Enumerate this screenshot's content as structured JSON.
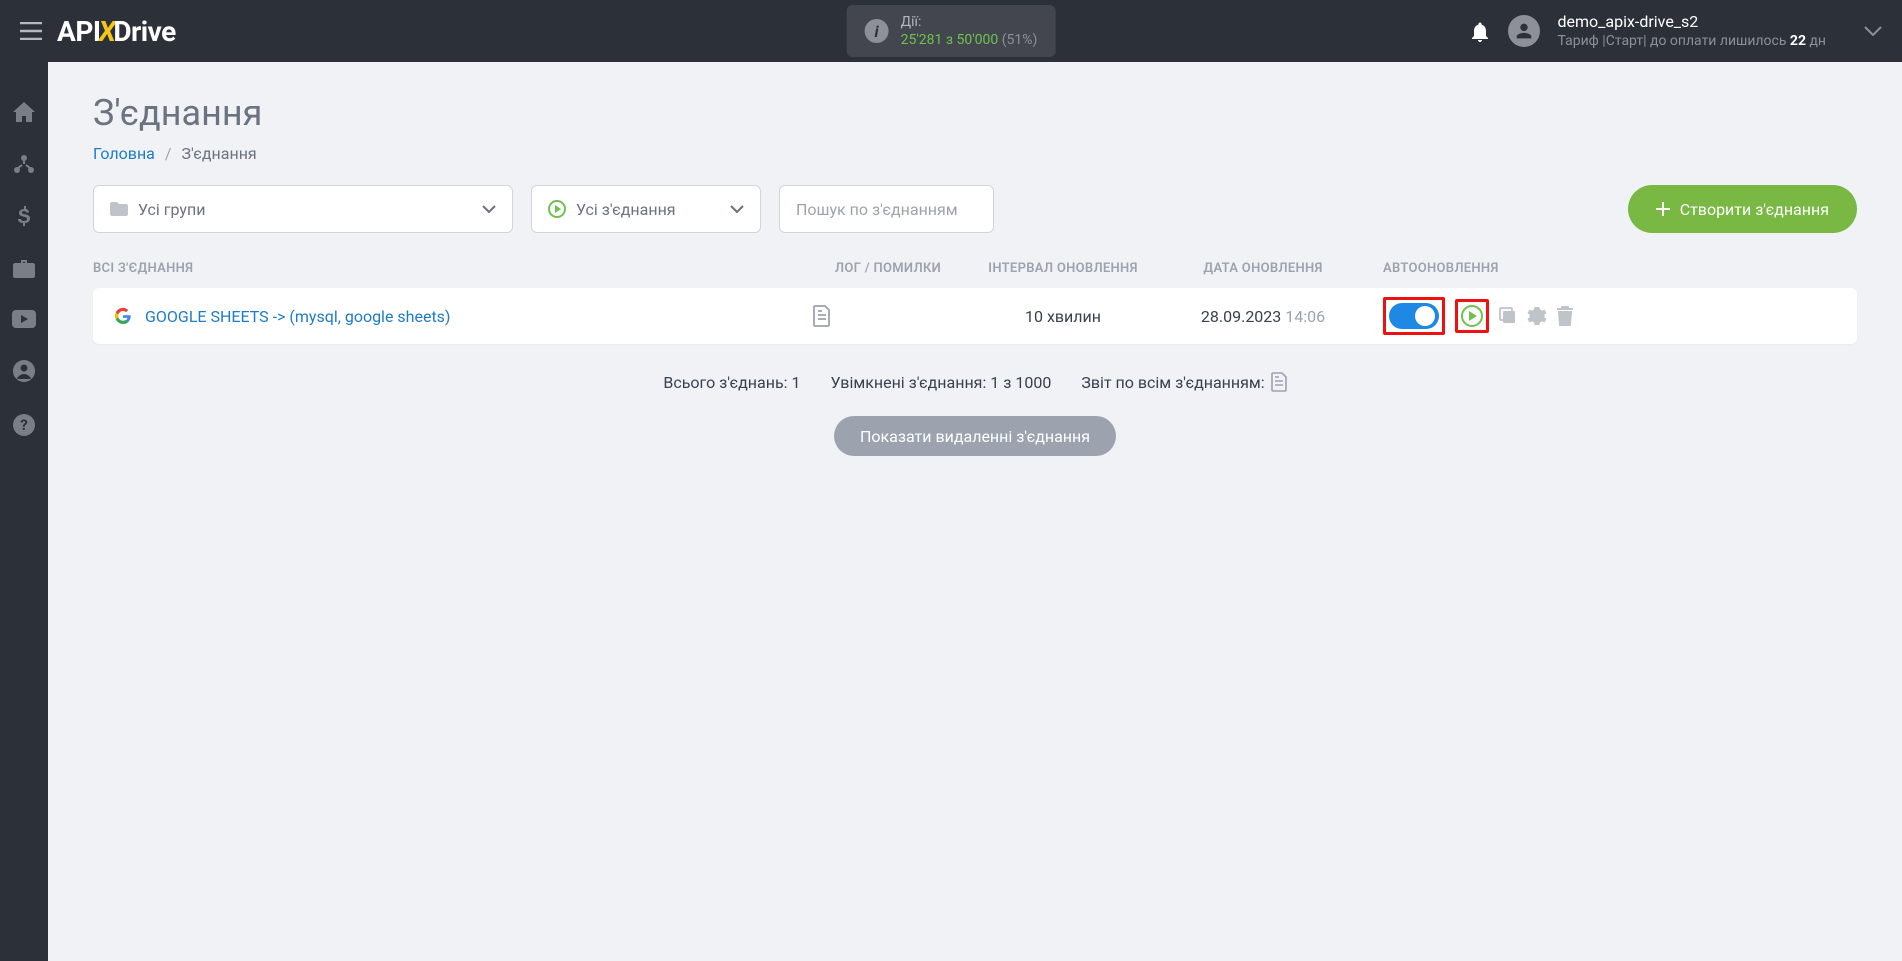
{
  "header": {
    "logo_pre": "API",
    "logo_x": "X",
    "logo_post": "Drive",
    "actions_label": "Дії:",
    "actions_used": "25'281",
    "actions_sep": "з",
    "actions_total": "50'000",
    "actions_pct": "(51%)",
    "user_name": "demo_apix-drive_s2",
    "tariff_pre": "Тариф |Старт| до оплати лишилось ",
    "tariff_days": "22",
    "tariff_unit": " дн"
  },
  "page": {
    "title": "З'єднання",
    "bc_home": "Головна",
    "bc_current": "З'єднання"
  },
  "controls": {
    "groups": "Усі групи",
    "status": "Усі з'єднання",
    "search_ph": "Пошук по з'єднанням",
    "create": "Створити з'єднання"
  },
  "cols": {
    "name": "ВСІ З'ЄДНАННЯ",
    "log": "ЛОГ / ПОМИЛКИ",
    "interval": "ІНТЕРВАЛ ОНОВЛЕННЯ",
    "date": "ДАТА ОНОВЛЕННЯ",
    "auto": "АВТООНОВЛЕННЯ"
  },
  "row": {
    "name": "GOOGLE SHEETS -> (mysql, google sheets)",
    "interval": "10 хвилин",
    "date": "28.09.2023",
    "time": "14:06"
  },
  "summary": {
    "total": "Всього з'єднань: 1",
    "enabled": "Увімкнені з'єднання: 1 з 1000",
    "report": "Звіт по всім з'єднанням:"
  },
  "show_deleted": "Показати видаленні з'єднання"
}
